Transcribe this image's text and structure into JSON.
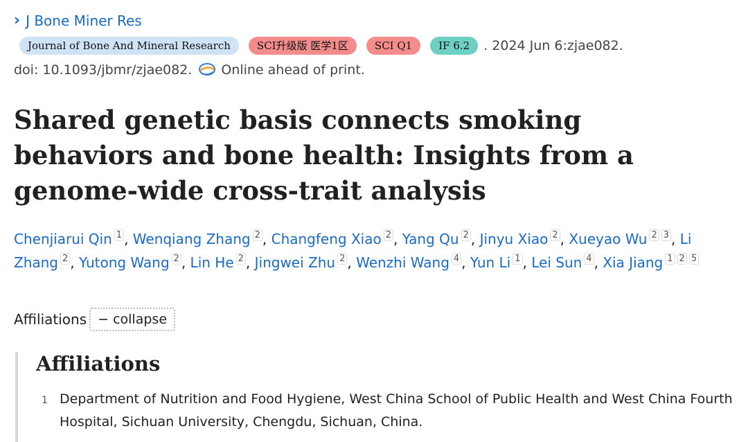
{
  "journal_link": {
    "chevron": "›",
    "label": "J Bone Miner Res"
  },
  "badges": [
    {
      "label": "Journal of Bone And Mineral Research",
      "color": "#cfe3f7"
    },
    {
      "label": "SCI升级版 医学1区",
      "color": "#f48c8c"
    },
    {
      "label": "SCI Q1",
      "color": "#f48c8c"
    },
    {
      "label": "IF 6.2",
      "color": "#6cd1c2"
    }
  ],
  "pub_date": ". 2024 Jun 6:zjae082.",
  "doi": "doi: 10.1093/jbmr/zjae082.",
  "online_status": "Online ahead of print.",
  "title": "Shared genetic basis connects smoking behaviors and bone health: Insights from a genome-wide cross-trait analysis",
  "authors": [
    {
      "name": "Chenjiarui Qin",
      "aff": [
        "1"
      ]
    },
    {
      "name": "Wenqiang Zhang",
      "aff": [
        "2"
      ]
    },
    {
      "name": "Changfeng Xiao",
      "aff": [
        "2"
      ]
    },
    {
      "name": "Yang Qu",
      "aff": [
        "2"
      ]
    },
    {
      "name": "Jinyu Xiao",
      "aff": [
        "2"
      ]
    },
    {
      "name": "Xueyao Wu",
      "aff": [
        "2",
        "3"
      ]
    },
    {
      "name": "Li Zhang",
      "aff": [
        "2"
      ]
    },
    {
      "name": "Yutong Wang",
      "aff": [
        "2"
      ]
    },
    {
      "name": "Lin He",
      "aff": [
        "2"
      ]
    },
    {
      "name": "Jingwei Zhu",
      "aff": [
        "2"
      ]
    },
    {
      "name": "Wenzhi Wang",
      "aff": [
        "4"
      ]
    },
    {
      "name": "Yun Li",
      "aff": [
        "1"
      ]
    },
    {
      "name": "Lei Sun",
      "aff": [
        "4"
      ]
    },
    {
      "name": "Xia Jiang",
      "aff": [
        "1",
        "2",
        "5"
      ]
    }
  ],
  "affiliations_toggle": {
    "label": "Affiliations",
    "button": "− collapse"
  },
  "affiliations_panel": {
    "heading": "Affiliations",
    "items": [
      {
        "num": "1",
        "text": "Department of Nutrition and Food Hygiene, West China School of Public Health and West China Fourth Hospital, Sichuan University, Chengdu, Sichuan, China."
      }
    ]
  },
  "colors": {
    "link": "#1a6ac9",
    "accent_red": "#f48c8c",
    "accent_teal": "#6cd1c2"
  }
}
